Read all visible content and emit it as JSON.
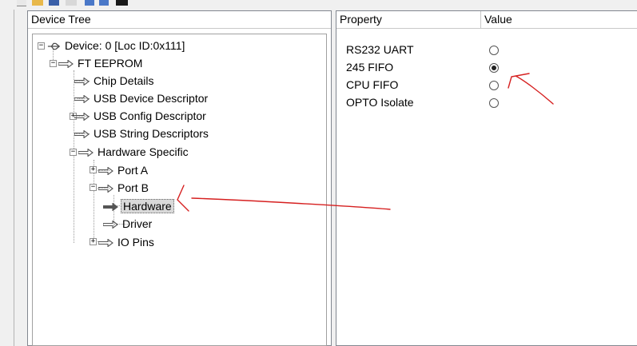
{
  "toolbar": {
    "icons": [
      "new-icon",
      "open-icon",
      "save-icon",
      "program-icon",
      "wand-icon",
      "wand2-icon",
      "terminal-icon"
    ]
  },
  "tree": {
    "header": "Device Tree",
    "device": "Device: 0 [Loc ID:0x111]",
    "ft_eeprom": "FT EEPROM",
    "chip_details": "Chip Details",
    "usb_device_descriptor": "USB Device Descriptor",
    "usb_config_descriptor": "USB Config Descriptor",
    "usb_string_descriptors": "USB String Descriptors",
    "hardware_specific": "Hardware Specific",
    "port_a": "Port A",
    "port_b": "Port B",
    "hardware": "Hardware",
    "driver": "Driver",
    "io_pins": "IO Pins",
    "selected": "Hardware"
  },
  "properties": {
    "header_property": "Property",
    "header_value": "Value",
    "rows": [
      {
        "label": "RS232 UART",
        "checked": false
      },
      {
        "label": "245 FIFO",
        "checked": true
      },
      {
        "label": "CPU FIFO",
        "checked": false
      },
      {
        "label": "OPTO Isolate",
        "checked": false
      }
    ]
  },
  "colors": {
    "annotation": "#d62020",
    "arrow": "#555555",
    "border": "#828790"
  }
}
